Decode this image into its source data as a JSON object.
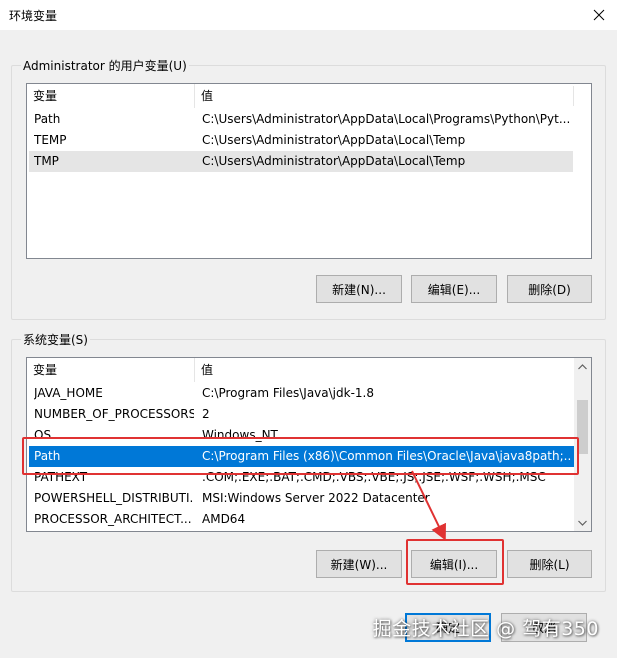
{
  "window": {
    "title": "环境变量"
  },
  "user_vars": {
    "legend": "Administrator 的用户变量(U)",
    "headers": {
      "name": "变量",
      "value": "值"
    },
    "rows": [
      {
        "name": "Path",
        "value": "C:\\Users\\Administrator\\AppData\\Local\\Programs\\Python\\Pyt..."
      },
      {
        "name": "TEMP",
        "value": "C:\\Users\\Administrator\\AppData\\Local\\Temp"
      },
      {
        "name": "TMP",
        "value": "C:\\Users\\Administrator\\AppData\\Local\\Temp"
      }
    ],
    "buttons": {
      "new": "新建(N)...",
      "edit": "编辑(E)...",
      "delete": "删除(D)"
    }
  },
  "system_vars": {
    "legend": "系统变量(S)",
    "headers": {
      "name": "变量",
      "value": "值"
    },
    "rows": [
      {
        "name": "JAVA_HOME",
        "value": "C:\\Program Files\\Java\\jdk-1.8"
      },
      {
        "name": "NUMBER_OF_PROCESSORS",
        "value": "2"
      },
      {
        "name": "OS",
        "value": "Windows_NT"
      },
      {
        "name": "Path",
        "value": "C:\\Program Files (x86)\\Common Files\\Oracle\\Java\\java8path;..."
      },
      {
        "name": "PATHEXT",
        "value": ".COM;.EXE;.BAT;.CMD;.VBS;.VBE;.JS;.JSE;.WSF;.WSH;.MSC"
      },
      {
        "name": "POWERSHELL_DISTRIBUTI...",
        "value": "MSI:Windows Server 2022 Datacenter"
      },
      {
        "name": "PROCESSOR_ARCHITECT...",
        "value": "AMD64"
      }
    ],
    "selected_row": "Path",
    "buttons": {
      "new": "新建(W)...",
      "edit": "编辑(I)...",
      "delete": "删除(L)"
    }
  },
  "footer": {
    "ok": "确定",
    "cancel": "取消"
  },
  "watermark": "掘金技术社区 @ 驾有350",
  "colors": {
    "selection": "#0078d7",
    "annotation": "#e03232"
  }
}
